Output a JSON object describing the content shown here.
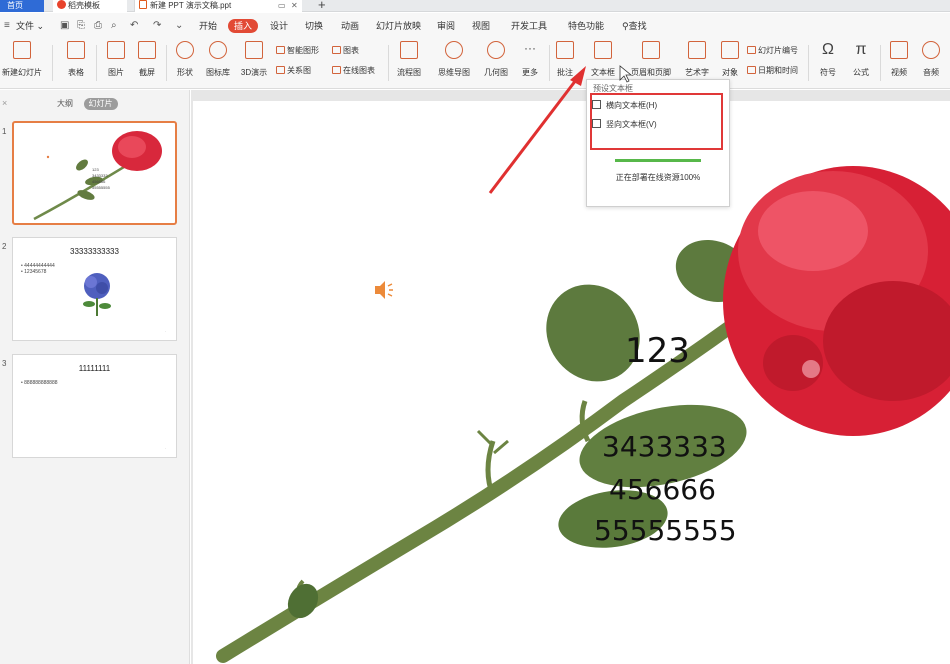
{
  "tabs": {
    "home": "首页",
    "template": "稻壳模板",
    "document": "新建 PPT 演示文稿.ppt",
    "add_symbol": "+"
  },
  "menu": {
    "file": "文件",
    "items": [
      "开始",
      "插入",
      "设计",
      "切换",
      "动画",
      "幻灯片放映",
      "审阅",
      "视图",
      "开发工具",
      "特色功能"
    ],
    "active": "插入",
    "search": "查找"
  },
  "ribbon": {
    "new_slide": "新建幻灯片",
    "table": "表格",
    "picture": "图片",
    "screenshot": "截屏",
    "shape": "形状",
    "icon_lib": "图标库",
    "demo_3d": "3D演示",
    "smart_art": "智能图形",
    "chart": "图表",
    "relation": "关系图",
    "online_chart": "在线图表",
    "flowchart": "流程图",
    "mindmap": "思维导图",
    "geometry": "几何图",
    "more": "更多",
    "comment": "批注",
    "textbox": "文本框",
    "header_footer": "页眉和页脚",
    "art_text": "艺术字",
    "object": "对象",
    "slide_number": "幻灯片编号",
    "datetime": "日期和时间",
    "symbol": "符号",
    "formula": "公式",
    "video": "视频",
    "audio": "音频"
  },
  "left_panel": {
    "outline_tab": "大纲",
    "slides_tab": "幻灯片",
    "slides": [
      {
        "number": "1",
        "lines": [
          "123",
          "3433333",
          "456666",
          "55555555"
        ]
      },
      {
        "number": "2",
        "title": "33333333333",
        "bullets": [
          "44444444444",
          "12345678"
        ]
      },
      {
        "number": "3",
        "title": "11111111",
        "bullets": [
          "888888888888"
        ]
      }
    ]
  },
  "slide": {
    "texts": [
      "123",
      "3433333",
      "456666",
      "55555555"
    ]
  },
  "dropdown": {
    "header": "预设文本框",
    "horizontal": "横向文本框(H)",
    "vertical": "竖向文本框(V)",
    "status": "正在部署在线资源100%",
    "progress": 1.0
  },
  "colors": {
    "accent": "#e24a35",
    "tab_blue": "#2f6bd6",
    "highlight_red": "#e03838",
    "progress_green": "#57b84a"
  }
}
